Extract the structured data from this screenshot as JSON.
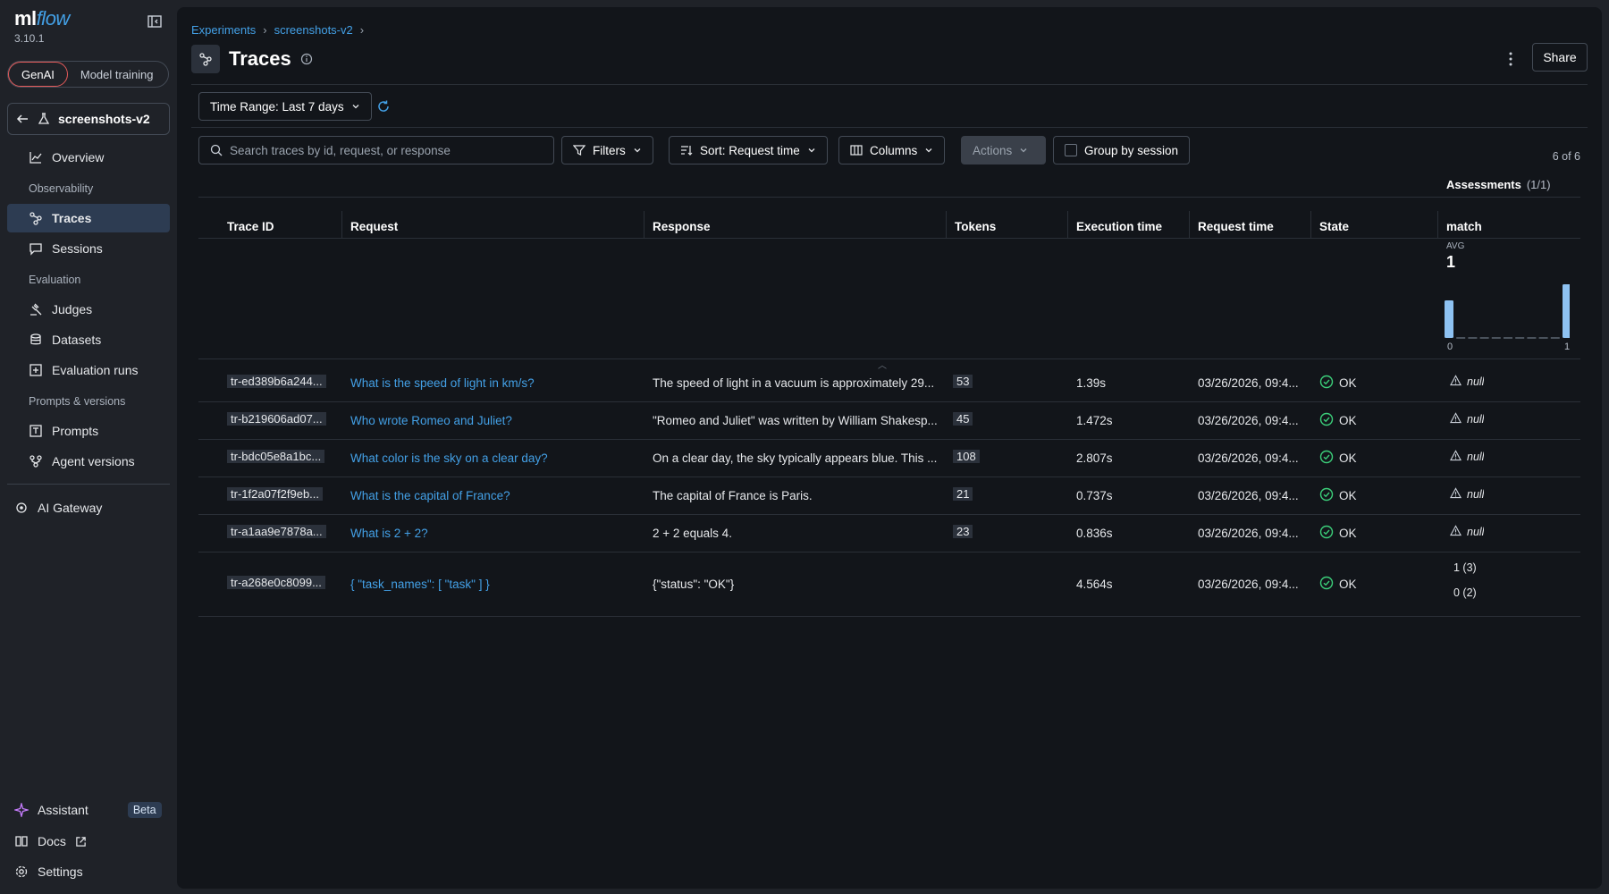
{
  "app": {
    "logo_main": "ml",
    "logo_accent": "flow",
    "version": "3.10.1"
  },
  "sidebar": {
    "modes": [
      "GenAI",
      "Model training"
    ],
    "experiment": "screenshots-v2",
    "sections": {
      "observability": "Observability",
      "evaluation": "Evaluation",
      "prompts": "Prompts & versions"
    },
    "items": {
      "overview": "Overview",
      "traces": "Traces",
      "sessions": "Sessions",
      "judges": "Judges",
      "datasets": "Datasets",
      "eval_runs": "Evaluation runs",
      "prompts": "Prompts",
      "agent_versions": "Agent versions",
      "ai_gateway": "AI Gateway"
    },
    "bottom": {
      "assistant": "Assistant",
      "beta": "Beta",
      "docs": "Docs",
      "settings": "Settings"
    }
  },
  "header": {
    "breadcrumb": [
      "Experiments",
      "screenshots-v2"
    ],
    "title": "Traces",
    "share": "Share"
  },
  "toolbar": {
    "time_range": "Time Range: Last 7 days",
    "search_placeholder": "Search traces by id, request, or response",
    "filters": "Filters",
    "sort": "Sort: Request time",
    "columns": "Columns",
    "actions": "Actions",
    "group_by": "Group by session",
    "count": "6 of 6"
  },
  "table": {
    "assessments_label": "Assessments",
    "assessments_count": "(1/1)",
    "headers": [
      "Trace ID",
      "Request",
      "Response",
      "Tokens",
      "Execution time",
      "Request time",
      "State",
      "match"
    ],
    "hist": {
      "avg_label": "AVG",
      "avg_value": "1",
      "x_min": "0",
      "x_max": "1",
      "bins": [
        0.7,
        0,
        0,
        0,
        0,
        0,
        0,
        0,
        0,
        0,
        1.0
      ]
    },
    "rows": [
      {
        "id": "tr-ed389b6a244...",
        "request": "What is the speed of light in km/s?",
        "response": "The speed of light in a vacuum is approximately 29...",
        "tokens": "53",
        "exec": "1.39s",
        "req_time": "03/26/2026, 09:4...",
        "state": "OK",
        "match": "null"
      },
      {
        "id": "tr-b219606ad07...",
        "request": "Who wrote Romeo and Juliet?",
        "response": "\"Romeo and Juliet\" was written by William Shakesp...",
        "tokens": "45",
        "exec": "1.472s",
        "req_time": "03/26/2026, 09:4...",
        "state": "OK",
        "match": "null"
      },
      {
        "id": "tr-bdc05e8a1bc...",
        "request": "What color is the sky on a clear day?",
        "response": "On a clear day, the sky typically appears blue. This ...",
        "tokens": "108",
        "exec": "2.807s",
        "req_time": "03/26/2026, 09:4...",
        "state": "OK",
        "match": "null"
      },
      {
        "id": "tr-1f2a07f2f9eb...",
        "request": "What is the capital of France?",
        "response": "The capital of France is Paris.",
        "tokens": "21",
        "exec": "0.737s",
        "req_time": "03/26/2026, 09:4...",
        "state": "OK",
        "match": "null"
      },
      {
        "id": "tr-a1aa9e7878a...",
        "request": "What is 2 + 2?",
        "response": "2 + 2 equals 4.",
        "tokens": "23",
        "exec": "0.836s",
        "req_time": "03/26/2026, 09:4...",
        "state": "OK",
        "match": "null"
      },
      {
        "id": "tr-a268e0c8099...",
        "request": "{ \"task_names\": [ \"task\" ] }",
        "response": "{\"status\": \"OK\"}",
        "tokens": "",
        "exec": "4.564s",
        "req_time": "03/26/2026, 09:4...",
        "state": "OK",
        "match_a": "1 (3)",
        "match_b": "0 (2)"
      }
    ]
  },
  "colors": {
    "accent": "#43a0e6",
    "ok": "#3ccf7a",
    "bar": "#8ec2f2"
  }
}
